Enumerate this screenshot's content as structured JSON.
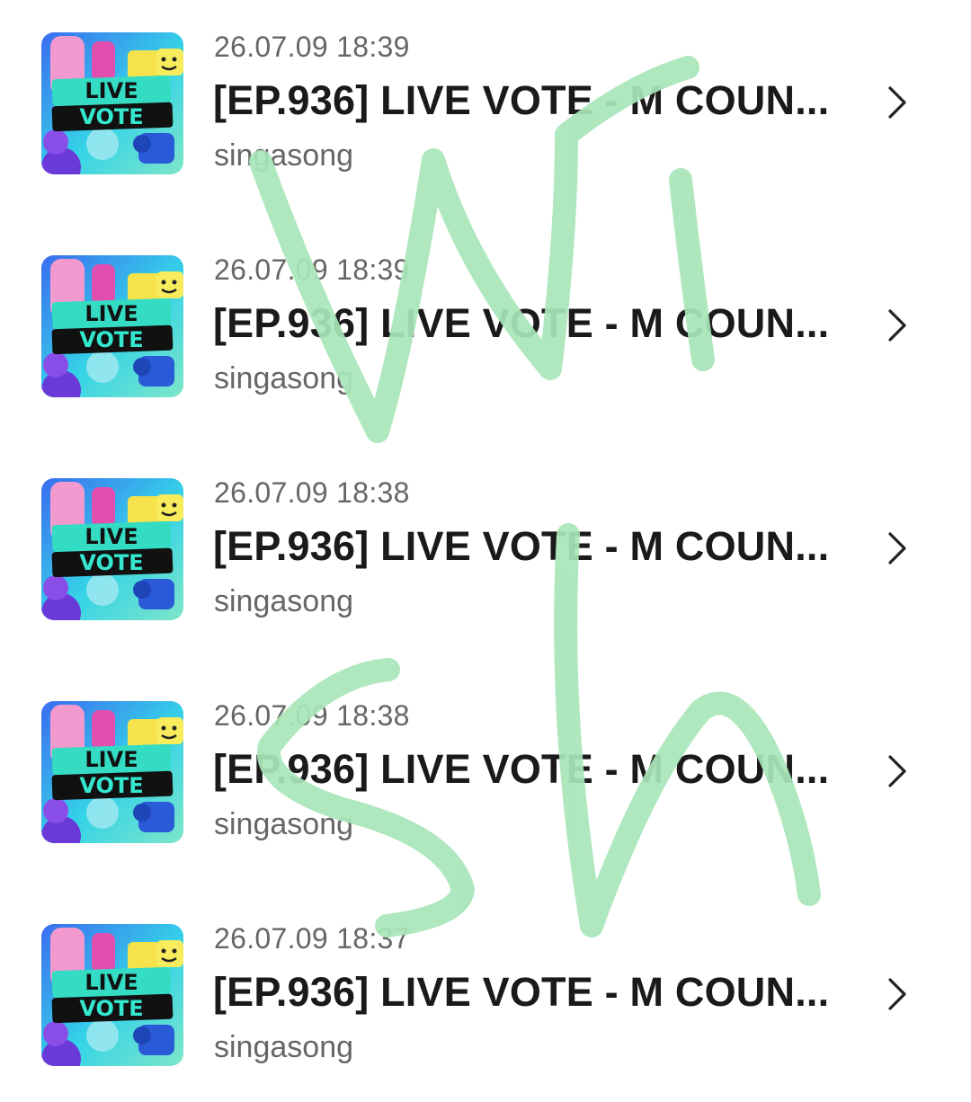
{
  "items": [
    {
      "date": "26.07.09 18:39",
      "title": "[EP.936] LIVE VOTE - M COUN...",
      "author": "singasong",
      "thumb_text": [
        "LIVE",
        "VOTE"
      ]
    },
    {
      "date": "26.07.09 18:39",
      "title": "[EP.936] LIVE VOTE - M COUN...",
      "author": "singasong",
      "thumb_text": [
        "LIVE",
        "VOTE"
      ]
    },
    {
      "date": "26.07.09 18:38",
      "title": "[EP.936] LIVE VOTE - M COUN...",
      "author": "singasong",
      "thumb_text": [
        "LIVE",
        "VOTE"
      ]
    },
    {
      "date": "26.07.09 18:38",
      "title": "[EP.936] LIVE VOTE - M COUN...",
      "author": "singasong",
      "thumb_text": [
        "LIVE",
        "VOTE"
      ]
    },
    {
      "date": "26.07.09 18:37",
      "title": "[EP.936] LIVE VOTE - M COUN...",
      "author": "singasong",
      "thumb_text": [
        "LIVE",
        "VOTE"
      ]
    }
  ],
  "icons": {
    "row_action": "chevron-right-icon"
  },
  "colors": {
    "scribble": "#a8e6b8",
    "title": "#1a1a1a",
    "meta": "#666666"
  }
}
